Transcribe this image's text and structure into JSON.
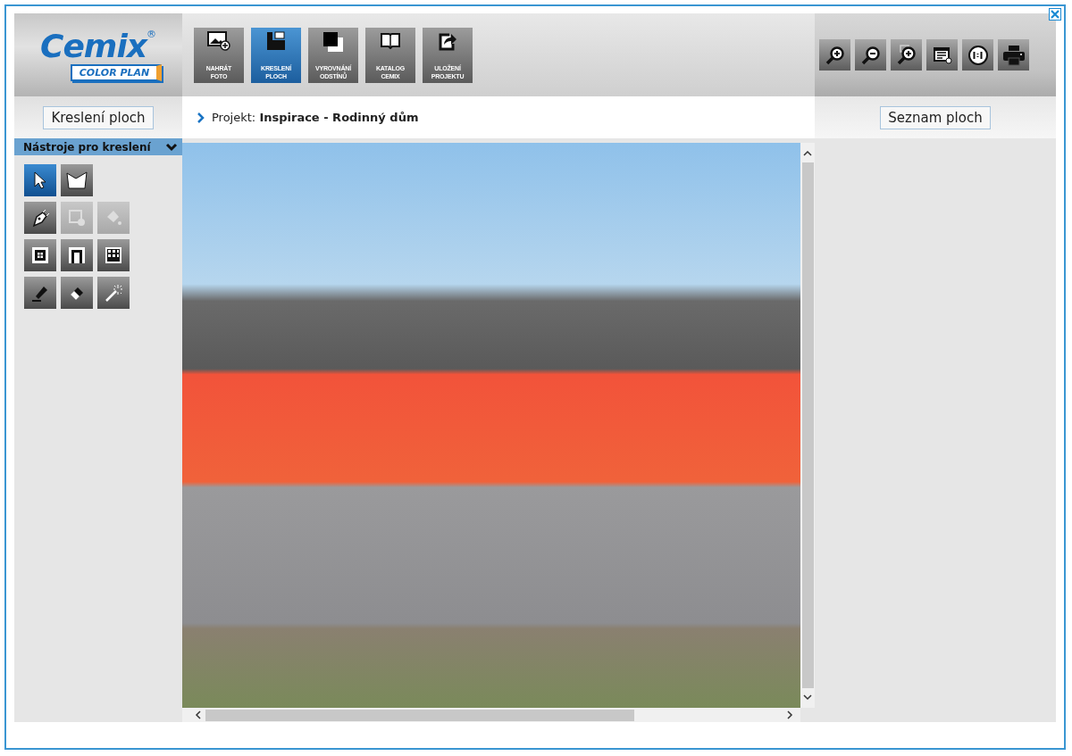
{
  "logo": {
    "brand": "Cemix",
    "registered": "®",
    "product": "COLOR PLAN"
  },
  "toolbar": [
    {
      "lines": [
        "NAHRÁT",
        "FOTO"
      ],
      "selected": false
    },
    {
      "lines": [
        "KRESLENÍ",
        "PLOCH"
      ],
      "selected": true
    },
    {
      "lines": [
        "VYROVNÁNÍ",
        "ODSTÍNŮ"
      ],
      "selected": false
    },
    {
      "lines": [
        "KATALOG",
        "CEMIX"
      ],
      "selected": false
    },
    {
      "lines": [
        "ULOŽENÍ",
        "PROJEKTU"
      ],
      "selected": false
    }
  ],
  "left_panel": {
    "title": "Kreslení ploch",
    "section": "Nástroje pro kreslení",
    "expanded": true,
    "tools": [
      [
        {
          "selected": true,
          "disabled": false
        },
        {
          "selected": false,
          "disabled": false
        }
      ],
      [
        {
          "selected": false,
          "disabled": false
        },
        {
          "selected": false,
          "disabled": true
        },
        {
          "selected": false,
          "disabled": true
        }
      ],
      [
        {
          "selected": false,
          "disabled": false
        },
        {
          "selected": false,
          "disabled": false
        },
        {
          "selected": false,
          "disabled": false
        }
      ],
      [
        {
          "selected": false,
          "disabled": false
        },
        {
          "selected": false,
          "disabled": false
        },
        {
          "selected": false,
          "disabled": false
        }
      ]
    ]
  },
  "breadcrumb": "Projekt: **Inspirace - Rodinný dům**",
  "right_panel": {
    "title": "Seznam ploch"
  }
}
